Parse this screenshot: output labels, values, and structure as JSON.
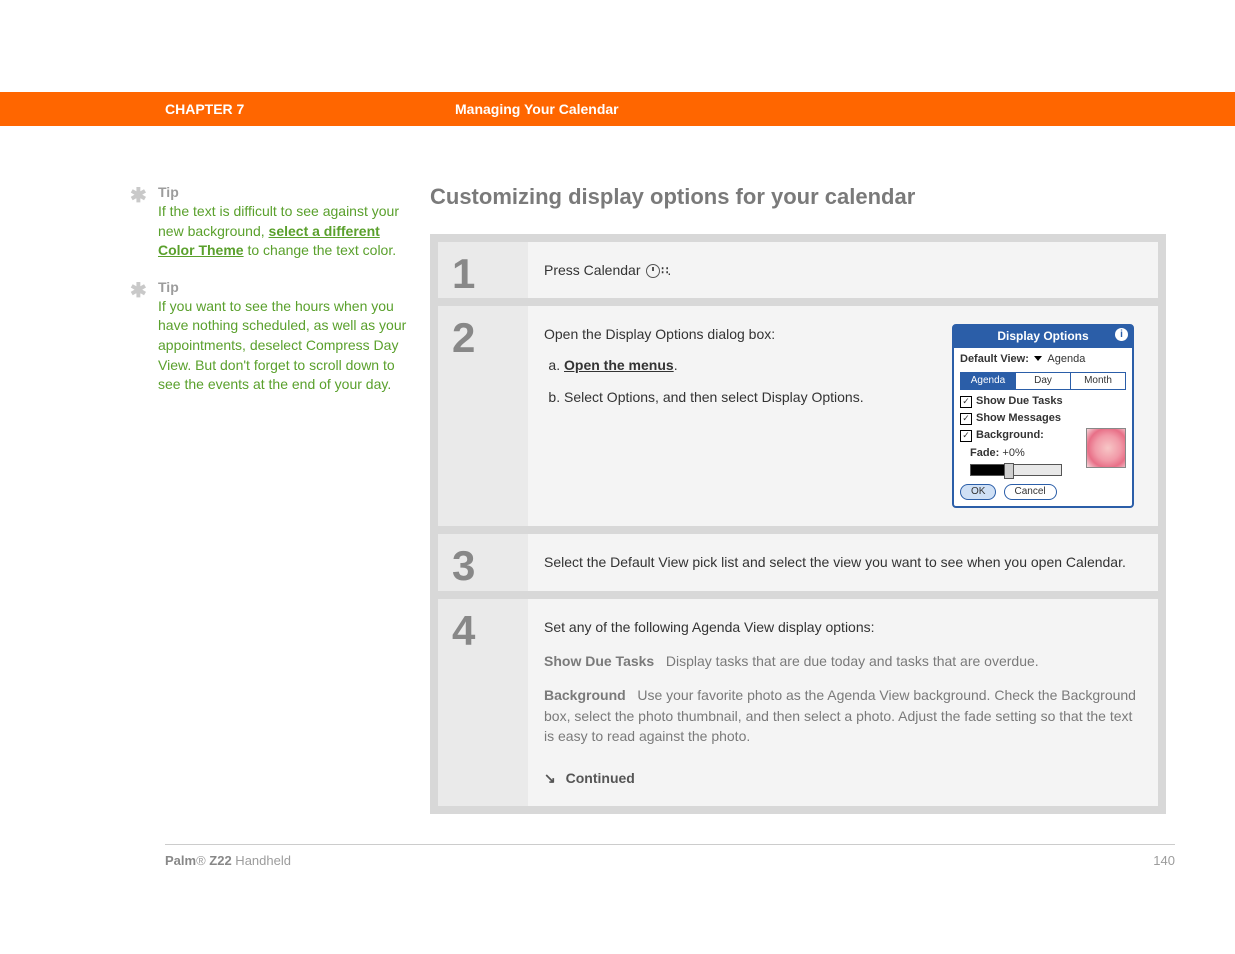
{
  "header": {
    "chapter_label": "CHAPTER 7",
    "chapter_title": "Managing Your Calendar"
  },
  "sidebar": {
    "tips": [
      {
        "label": "Tip",
        "text_before": "If the text is difficult to see against your new background, ",
        "link": "select a different Color Theme",
        "text_after": " to change the text color."
      },
      {
        "label": "Tip",
        "text_before": "If you want to see the hours when you have nothing scheduled, as well as your appointments, deselect Compress Day View. But don't forget to scroll down to see the events at the end of your day.",
        "link": "",
        "text_after": ""
      }
    ]
  },
  "content": {
    "heading": "Customizing display options for your calendar",
    "steps": [
      {
        "num": "1",
        "text": "Press Calendar "
      },
      {
        "num": "2",
        "intro": "Open the Display Options dialog box:",
        "sub_a_link": "Open the menus",
        "sub_a_after": ".",
        "sub_b": "Select Options, and then select Display Options."
      },
      {
        "num": "3",
        "text": "Select the Default View pick list and select the view you want to see when you open Calendar."
      },
      {
        "num": "4",
        "intro": "Set any of the following Agenda View display options:",
        "opt1_label": "Show Due Tasks",
        "opt1_text": "Display tasks that are due today and tasks that are overdue.",
        "opt2_label": "Background",
        "opt2_text": "Use your favorite photo as the Agenda View background. Check the Background box, select the photo thumbnail, and then select a photo. Adjust the fade setting so that the text is easy to read against the photo.",
        "continued": "Continued"
      }
    ]
  },
  "dialog": {
    "title": "Display Options",
    "default_view_label": "Default View:",
    "default_view_value": "Agenda",
    "tabs": [
      "Agenda",
      "Day",
      "Month"
    ],
    "active_tab": 0,
    "checks": [
      {
        "label": "Show Due Tasks",
        "checked": true
      },
      {
        "label": "Show Messages",
        "checked": true
      },
      {
        "label": "Background:",
        "checked": true
      }
    ],
    "fade_label": "Fade:",
    "fade_value": "+0%",
    "ok": "OK",
    "cancel": "Cancel"
  },
  "footer": {
    "product_bold": "Palm",
    "product_reg": "®",
    "product_model": " Z22",
    "product_tail": " Handheld",
    "page": "140"
  }
}
